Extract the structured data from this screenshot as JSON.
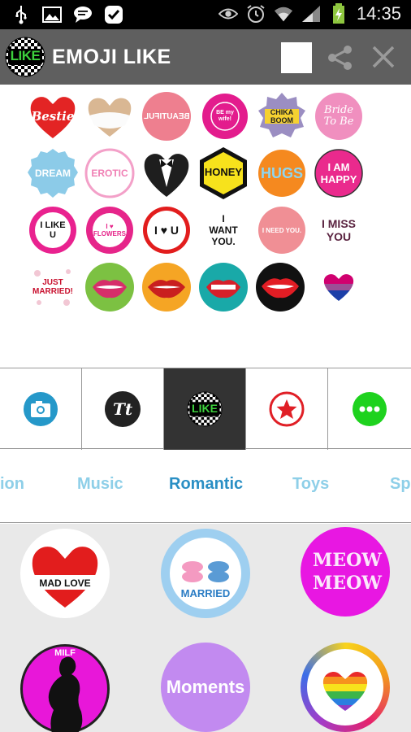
{
  "status_bar": {
    "time": "14:35",
    "left_icons": [
      "usb-icon",
      "image-icon",
      "chat-icon",
      "check-badge-icon"
    ],
    "right_icons": [
      "eye-icon",
      "alarm-icon",
      "wifi-icon",
      "signal-icon",
      "battery-charging-icon"
    ]
  },
  "app_bar": {
    "logo_text": "LIKE",
    "title": "EMOJI LIKE",
    "background": "#5f5f5f"
  },
  "stickers": [
    {
      "name": "bestie",
      "text": "Bestie"
    },
    {
      "name": "dress",
      "text": ""
    },
    {
      "name": "beautiful",
      "text": "BEAUTIFUL"
    },
    {
      "name": "be-my-wife",
      "text": "BE my wife!"
    },
    {
      "name": "chika-boom",
      "text": "CHIKA BOOM"
    },
    {
      "name": "bride-to-be",
      "text": "Bride To Be"
    },
    {
      "name": "dream",
      "text": "DREAM"
    },
    {
      "name": "erotic",
      "text": "EROTIC"
    },
    {
      "name": "tuxedo",
      "text": ""
    },
    {
      "name": "honey",
      "text": "HONEY"
    },
    {
      "name": "hugs",
      "text": "HUGS"
    },
    {
      "name": "i-am-happy",
      "text": "I AM HAPPY"
    },
    {
      "name": "i-like-u",
      "text": "I LIKE U"
    },
    {
      "name": "i-love-flowers",
      "text": "I ♥ FLOWERS"
    },
    {
      "name": "i-love-u",
      "text": "I ♥ U"
    },
    {
      "name": "i-want-you",
      "text": "I WANT YOU."
    },
    {
      "name": "i-need-you",
      "text": "I NEED YOU."
    },
    {
      "name": "i-miss-you",
      "text": "I MISS YOU"
    },
    {
      "name": "just-married",
      "text": "JUST MARRIED!"
    },
    {
      "name": "lips-bite-green",
      "text": ""
    },
    {
      "name": "lips-bite-orange",
      "text": ""
    },
    {
      "name": "lips-teal",
      "text": ""
    },
    {
      "name": "vampire-lips",
      "text": ""
    },
    {
      "name": "bi-heart",
      "text": ""
    }
  ],
  "tools": [
    {
      "name": "camera-tool",
      "icon": "camera-icon"
    },
    {
      "name": "text-tool",
      "icon": "text-tt-icon",
      "glyph": "Tt"
    },
    {
      "name": "like-tool",
      "icon": "like-logo-icon",
      "glyph": "LIKE",
      "selected": true
    },
    {
      "name": "star-tool",
      "icon": "star-icon"
    },
    {
      "name": "more-tool",
      "icon": "more-dots-icon"
    }
  ],
  "tabs": [
    {
      "label": "ion",
      "active": false
    },
    {
      "label": "Music",
      "active": false
    },
    {
      "label": "Romantic",
      "active": true
    },
    {
      "label": "Toys",
      "active": false
    },
    {
      "label": "Sp",
      "active": false
    }
  ],
  "gallery": [
    {
      "name": "mad-love",
      "text": "MAD LOVE"
    },
    {
      "name": "married",
      "text": "MARRIED"
    },
    {
      "name": "meow-meow",
      "text": "MEOW MEOW"
    },
    {
      "name": "milf",
      "text": "MILF"
    },
    {
      "name": "moments",
      "text": "Moments"
    },
    {
      "name": "rainbow-heart",
      "text": ""
    }
  ]
}
